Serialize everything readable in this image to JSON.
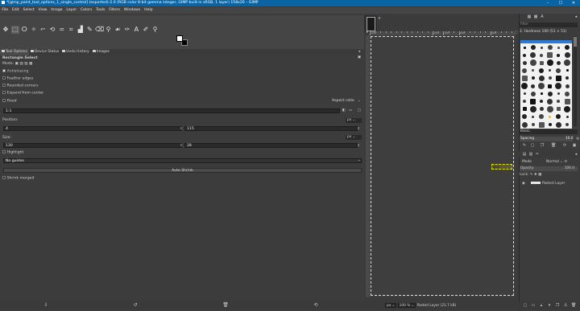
{
  "window": {
    "title": "*[gimp_paint_tool_options_1_single_control] (exported)-2.0 (RGB color 8-bit gamma integer, GIMP built-in sRGB, 1 layer) 158x20 – GIMP",
    "minimize": "–",
    "maximize": "☐",
    "close": "✕"
  },
  "menu": [
    "File",
    "Edit",
    "Select",
    "View",
    "Image",
    "Layer",
    "Colors",
    "Tools",
    "Filters",
    "Windows",
    "Help"
  ],
  "toolbox": {
    "icons": [
      "move-icon",
      "rect-select-icon",
      "lasso-icon",
      "fuzzy-select-icon",
      "crop-icon",
      "unified-transform-icon",
      "warp-transform-icon",
      "cage-icon",
      "bucket-fill-icon",
      "paintbrush-icon",
      "eraser-icon",
      "clone-icon",
      "smudge-icon",
      "paths-icon",
      "text-icon",
      "color-picker-icon",
      "zoom-icon"
    ],
    "glyphs": [
      "✥",
      "⬚",
      "ⵔ",
      "✧",
      "⌐",
      "⟲",
      "⋍",
      "⌗",
      "▟",
      "✎",
      "⌫",
      "⚲",
      "☙",
      "✑",
      "A",
      "✐",
      "⚲"
    ]
  },
  "tabs": {
    "tool_options": "Tool Options",
    "device_status": "Device Status",
    "undo_history": "Undo History",
    "images": "Images"
  },
  "options": {
    "heading": "Rectangle Select",
    "mode_label": "Mode:",
    "antialiasing": "Antialiasing",
    "feather_edges": "Feather edges",
    "rounded_corners": "Rounded corners",
    "expand_from_center": "Expand from center",
    "fixed_label": "Fixed",
    "fixed_value": "Aspect ratio",
    "ratio_value": "1:1",
    "position_label": "Position:",
    "position_x": "4",
    "position_y": "115",
    "position_unit": "px",
    "size_label": "Size:",
    "size_w": "130",
    "size_h": "28",
    "size_unit": "px",
    "highlight": "Highlight",
    "guides": "No guides",
    "auto_shrink": "Auto Shrink",
    "shrink_merged": "Shrink merged"
  },
  "ruler": {
    "ticks": [
      "100",
      "",
      "",
      "",
      "",
      "",
      "",
      "",
      "",
      "",
      "",
      "",
      "200",
      "",
      "300",
      "",
      "",
      "400",
      "",
      "",
      "",
      "",
      "",
      "500",
      "",
      "",
      "",
      ""
    ]
  },
  "canvas": {
    "pasted_label": "Wire"
  },
  "status": {
    "unit": "px",
    "zoom": "100 %",
    "layer_info": "Pasted Layer (21.7 kB)"
  },
  "brushes": {
    "filter_placeholder": "filter",
    "current_brush": "2. Hardness 100 (51 × 51)",
    "tag": "Basic,",
    "spacing_label": "Spacing",
    "spacing_value": "10.0"
  },
  "layers": {
    "mode_label": "Mode",
    "mode_value": "Normal",
    "opacity_label": "Opacity",
    "opacity_value": "100.0",
    "lock_label": "Lock:",
    "layer_name": "Pasted Layer"
  }
}
